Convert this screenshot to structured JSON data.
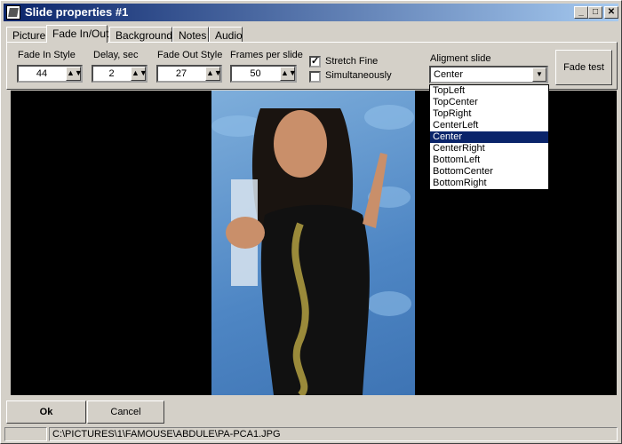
{
  "window": {
    "title": "Slide properties #1"
  },
  "tabs": [
    {
      "label": "Picture"
    },
    {
      "label": "Fade In/Out"
    },
    {
      "label": "Background"
    },
    {
      "label": "Notes"
    },
    {
      "label": "Audio"
    }
  ],
  "fade": {
    "fade_in_label": "Fade In Style",
    "fade_in_value": "44",
    "delay_label": "Delay, sec",
    "delay_value": "2",
    "fade_out_label": "Fade Out Style",
    "fade_out_value": "27",
    "fps_label": "Frames per slide",
    "fps_value": "50",
    "stretch_label": "Stretch Fine",
    "stretch_checked": true,
    "simult_label": "Simultaneously",
    "simult_checked": false,
    "align_label": "Aligment slide",
    "align_value": "Center",
    "align_options": [
      "TopLeft",
      "TopCenter",
      "TopRight",
      "CenterLeft",
      "Center",
      "CenterRight",
      "BottomLeft",
      "BottomCenter",
      "BottomRight"
    ],
    "fade_test_label": "Fade test"
  },
  "buttons": {
    "ok": "Ok",
    "cancel": "Cancel"
  },
  "status": {
    "path": "C:\\PICTURES\\1\\FAMOUSE\\ABDULE\\PA-PCA1.JPG"
  }
}
